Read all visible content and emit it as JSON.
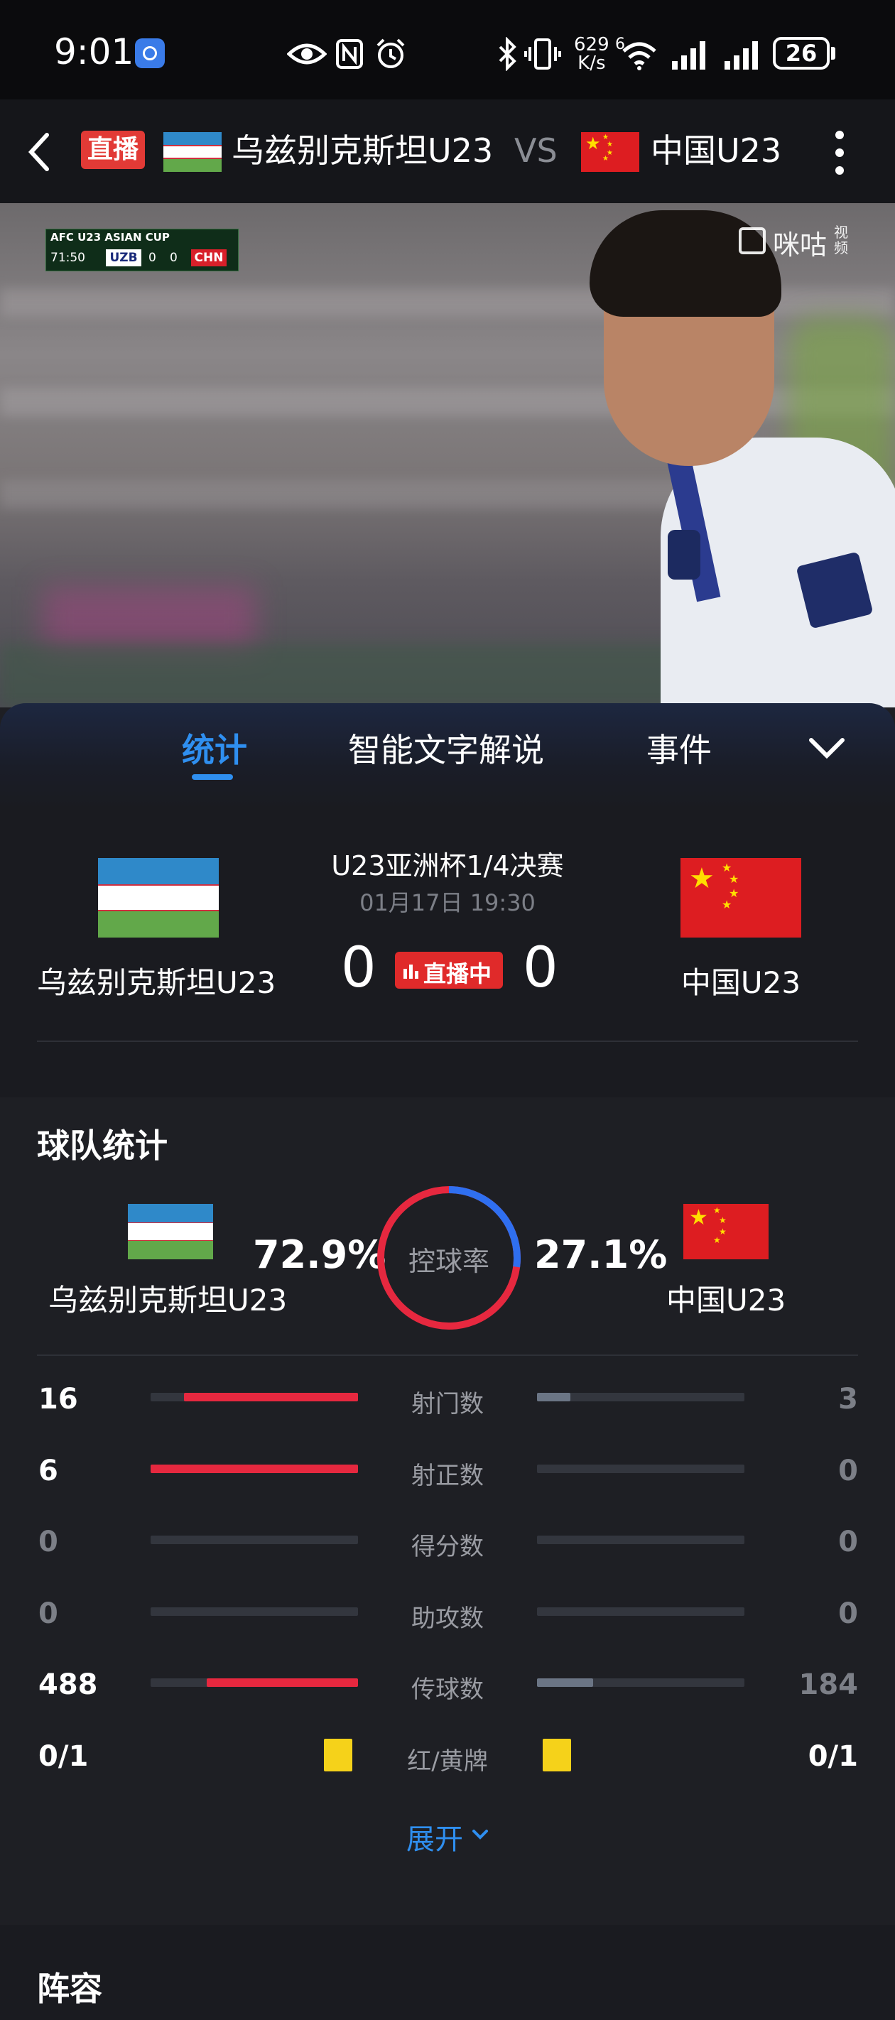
{
  "status": {
    "time": "9:01",
    "net_speed_top": "629",
    "net_speed_unit": "K/s",
    "wifi_badge": "6",
    "battery": "26"
  },
  "nav": {
    "live_badge": "直播",
    "home_team": "乌兹别克斯坦U23",
    "vs": "VS",
    "away_team": "中国U23"
  },
  "video": {
    "overlay_title": "AFC U23 ASIAN CUP",
    "overlay_time": "71:50",
    "overlay_home": "UZB",
    "overlay_home_score": "0",
    "overlay_away_score": "0",
    "overlay_away": "CHN",
    "watermark": "咪咕",
    "watermark_sub": "视频"
  },
  "tabs": {
    "items": [
      "统计",
      "智能文字解说",
      "事件"
    ],
    "active": 0
  },
  "match": {
    "competition": "U23亚洲杯1/4决赛",
    "datetime": "01月17日 19:30",
    "home_name": "乌兹别克斯坦U23",
    "away_name": "中国U23",
    "home_score": "0",
    "away_score": "0",
    "live_status": "直播中"
  },
  "team_stats": {
    "title": "球队统计",
    "home_name": "乌兹别克斯坦U23",
    "away_name": "中国U23",
    "possession_label": "控球率",
    "home_possession": "72.9%",
    "away_possession": "27.1%",
    "home_possession_value": 72.9,
    "rows": [
      {
        "label": "射门数",
        "home": "16",
        "away": "3",
        "home_frac": 0.84,
        "away_frac": 0.16
      },
      {
        "label": "射正数",
        "home": "6",
        "away": "0",
        "home_frac": 1.0,
        "away_frac": 0.0
      },
      {
        "label": "得分数",
        "home": "0",
        "away": "0",
        "home_frac": 0.0,
        "away_frac": 0.0
      },
      {
        "label": "助攻数",
        "home": "0",
        "away": "0",
        "home_frac": 0.0,
        "away_frac": 0.0
      },
      {
        "label": "传球数",
        "home": "488",
        "away": "184",
        "home_frac": 0.73,
        "away_frac": 0.27
      },
      {
        "label": "红/黄牌",
        "home": "0/1",
        "away": "0/1",
        "cards": true
      }
    ],
    "expand_label": "展开"
  },
  "lineup": {
    "title": "阵容"
  },
  "colors": {
    "accent_blue": "#2f8ff0",
    "live_red": "#e02a2a",
    "stat_red": "#e6283f"
  }
}
